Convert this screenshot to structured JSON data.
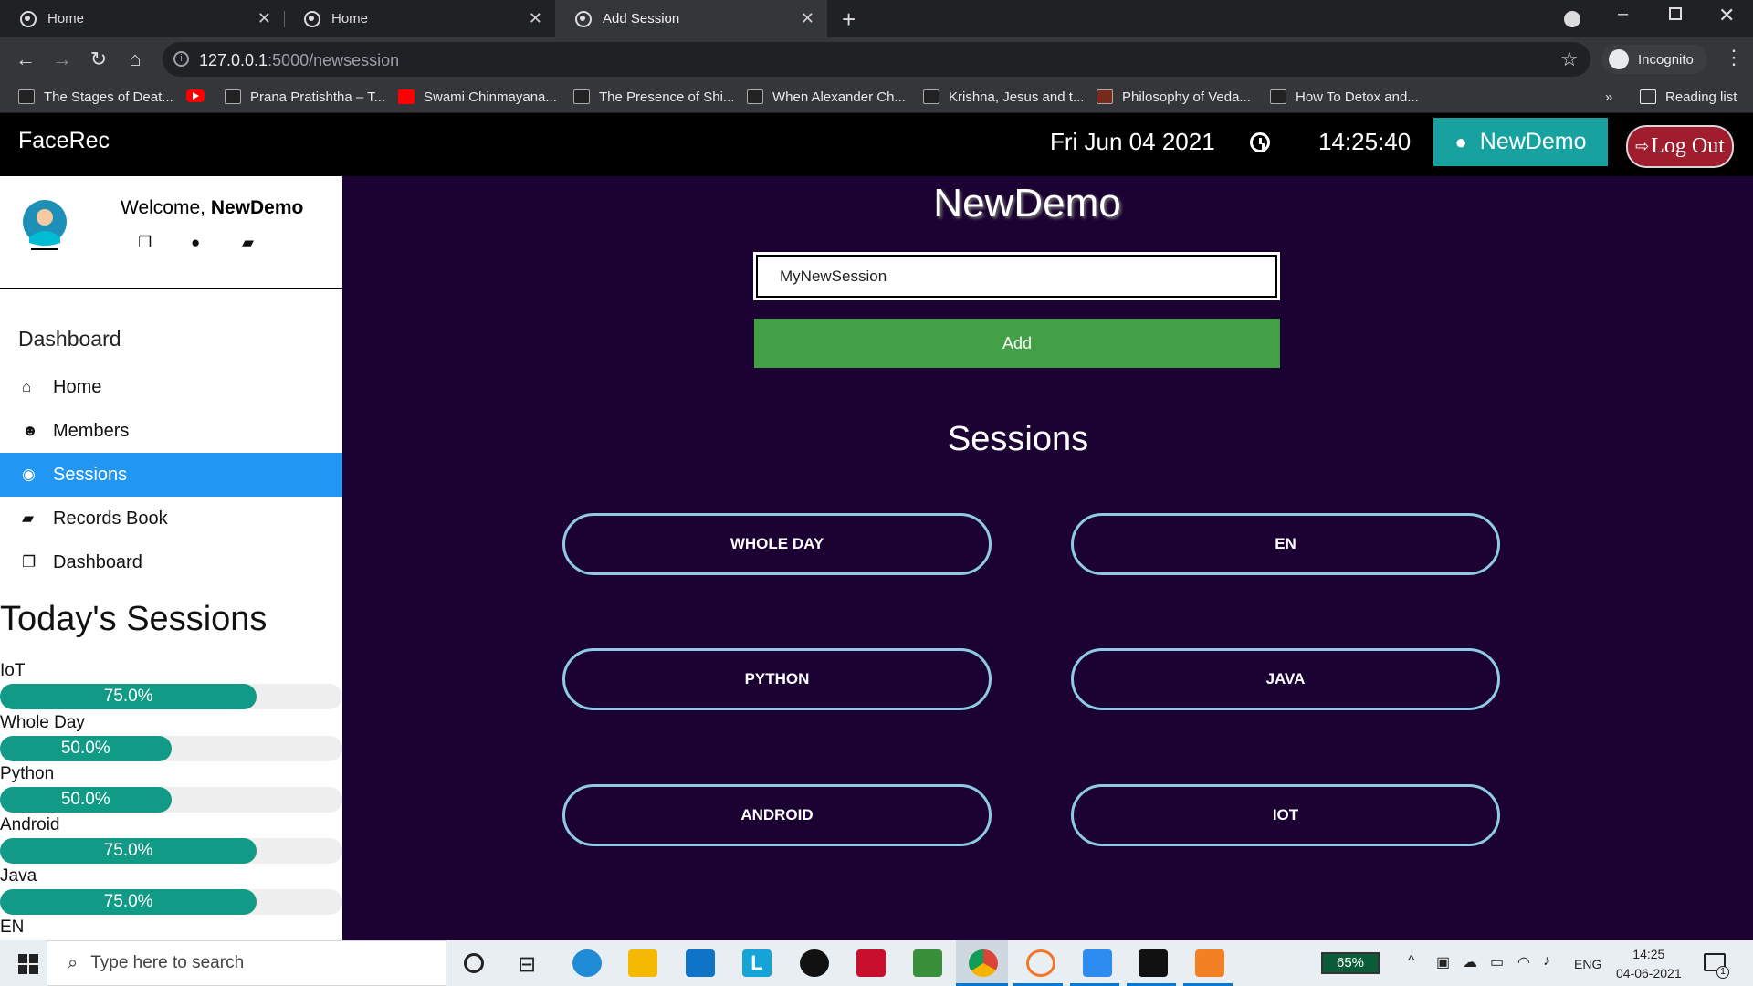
{
  "browser": {
    "tabs": [
      {
        "title": "Home",
        "active": false
      },
      {
        "title": "Home",
        "active": false
      },
      {
        "title": "Add Session",
        "active": true
      }
    ],
    "url_host": "127.0.0.1",
    "url_path": ":5000/newsession",
    "profile_label": "Incognito",
    "bookmarks": [
      "The Stages of Deat...",
      "Prana Pratishtha – T...",
      "Swami Chinmayana...",
      "The Presence of Shi...",
      "When Alexander Ch...",
      "Krishna, Jesus and t...",
      "Philosophy of Veda...",
      "How To Detox and..."
    ],
    "more_bookmarks": "»",
    "reading_list": "Reading list"
  },
  "app": {
    "brand": "FaceRec",
    "date": "Fri Jun 04 2021",
    "time": "14:25:40",
    "user_button": "NewDemo",
    "logout": "Log Out"
  },
  "sidebar": {
    "welcome_prefix": "Welcome, ",
    "welcome_name": "NewDemo",
    "section_title": "Dashboard",
    "nav": [
      {
        "label": "Home",
        "icon": "home-icon",
        "active": false
      },
      {
        "label": "Members",
        "icon": "users-icon",
        "active": false
      },
      {
        "label": "Sessions",
        "icon": "eye-icon",
        "active": true
      },
      {
        "label": "Records Book",
        "icon": "book-icon",
        "active": false
      },
      {
        "label": "Dashboard",
        "icon": "copy-icon",
        "active": false
      }
    ],
    "today_title": "Today's Sessions",
    "sessions_progress": [
      {
        "name": "IoT",
        "percent": 75.0,
        "label": "75.0%"
      },
      {
        "name": "Whole Day",
        "percent": 50.0,
        "label": "50.0%"
      },
      {
        "name": "Python",
        "percent": 50.0,
        "label": "50.0%"
      },
      {
        "name": "Android",
        "percent": 75.0,
        "label": "75.0%"
      },
      {
        "name": "Java",
        "percent": 75.0,
        "label": "75.0%"
      },
      {
        "name": "EN"
      }
    ]
  },
  "main": {
    "title": "NewDemo",
    "session_input_value": "MyNewSession",
    "add_button": "Add",
    "sessions_title": "Sessions",
    "sessions": [
      "WHOLE DAY",
      "EN",
      "PYTHON",
      "JAVA",
      "ANDROID",
      "IOT"
    ]
  },
  "taskbar": {
    "search_placeholder": "Type here to search",
    "battery": "65%",
    "language": "ENG",
    "clock_time": "14:25",
    "clock_date": "04-06-2021",
    "notification_count": "1"
  },
  "colors": {
    "main_bg": "#1c0232",
    "active_nav": "#2196f3",
    "progress": "#119b87",
    "add_button": "#43a047",
    "user_button": "#17a2a0",
    "logout": "#a01d2d",
    "pill_border": "#8ecae6"
  }
}
